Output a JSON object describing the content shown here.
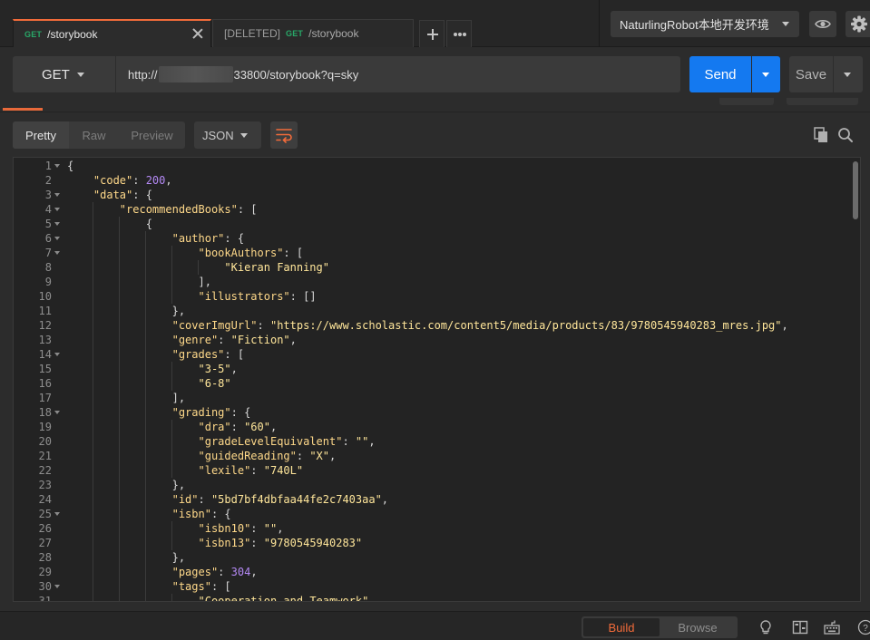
{
  "tabs": [
    {
      "method": "GET",
      "prefix": "",
      "path": "/storybook",
      "active": true
    },
    {
      "method": "GET",
      "prefix": "[DELETED]",
      "path": "/storybook",
      "active": false
    }
  ],
  "environment": {
    "selected": "NaturlingRobot本地开发环境"
  },
  "request": {
    "method": "GET",
    "url_prefix": "http://",
    "url_suffix": "33800/storybook?q=sky",
    "send_label": "Send",
    "save_label": "Save"
  },
  "response_toolbar": {
    "views": [
      "Pretty",
      "Raw",
      "Preview"
    ],
    "active_view": "Pretty",
    "format": "JSON"
  },
  "code_lines": [
    {
      "n": "1",
      "fold": true,
      "indent": 0,
      "tokens": [
        [
          "p",
          "{"
        ]
      ]
    },
    {
      "n": "2",
      "fold": false,
      "indent": 1,
      "tokens": [
        [
          "k",
          "\"code\""
        ],
        [
          "p",
          ": "
        ],
        [
          "n",
          "200"
        ],
        [
          "p",
          ","
        ]
      ]
    },
    {
      "n": "3",
      "fold": true,
      "indent": 1,
      "tokens": [
        [
          "k",
          "\"data\""
        ],
        [
          "p",
          ": {"
        ]
      ]
    },
    {
      "n": "4",
      "fold": true,
      "indent": 2,
      "tokens": [
        [
          "k",
          "\"recommendedBooks\""
        ],
        [
          "p",
          ": ["
        ]
      ]
    },
    {
      "n": "5",
      "fold": true,
      "indent": 3,
      "tokens": [
        [
          "p",
          "{"
        ]
      ]
    },
    {
      "n": "6",
      "fold": true,
      "indent": 4,
      "tokens": [
        [
          "k",
          "\"author\""
        ],
        [
          "p",
          ": {"
        ]
      ]
    },
    {
      "n": "7",
      "fold": true,
      "indent": 5,
      "tokens": [
        [
          "k",
          "\"bookAuthors\""
        ],
        [
          "p",
          ": ["
        ]
      ]
    },
    {
      "n": "8",
      "fold": false,
      "indent": 6,
      "tokens": [
        [
          "s",
          "\"Kieran Fanning\""
        ]
      ]
    },
    {
      "n": "9",
      "fold": false,
      "indent": 5,
      "tokens": [
        [
          "p",
          "],"
        ]
      ]
    },
    {
      "n": "10",
      "fold": false,
      "indent": 5,
      "tokens": [
        [
          "k",
          "\"illustrators\""
        ],
        [
          "p",
          ": []"
        ]
      ]
    },
    {
      "n": "11",
      "fold": false,
      "indent": 4,
      "tokens": [
        [
          "p",
          "},"
        ]
      ]
    },
    {
      "n": "12",
      "fold": false,
      "indent": 4,
      "tokens": [
        [
          "k",
          "\"coverImgUrl\""
        ],
        [
          "p",
          ": "
        ],
        [
          "s",
          "\"https://www.scholastic.com/content5/media/products/83/9780545940283_mres.jpg\""
        ],
        [
          "p",
          ","
        ]
      ]
    },
    {
      "n": "13",
      "fold": false,
      "indent": 4,
      "tokens": [
        [
          "k",
          "\"genre\""
        ],
        [
          "p",
          ": "
        ],
        [
          "s",
          "\"Fiction\""
        ],
        [
          "p",
          ","
        ]
      ]
    },
    {
      "n": "14",
      "fold": true,
      "indent": 4,
      "tokens": [
        [
          "k",
          "\"grades\""
        ],
        [
          "p",
          ": ["
        ]
      ]
    },
    {
      "n": "15",
      "fold": false,
      "indent": 5,
      "tokens": [
        [
          "s",
          "\"3-5\""
        ],
        [
          "p",
          ","
        ]
      ]
    },
    {
      "n": "16",
      "fold": false,
      "indent": 5,
      "tokens": [
        [
          "s",
          "\"6-8\""
        ]
      ]
    },
    {
      "n": "17",
      "fold": false,
      "indent": 4,
      "tokens": [
        [
          "p",
          "],"
        ]
      ]
    },
    {
      "n": "18",
      "fold": true,
      "indent": 4,
      "tokens": [
        [
          "k",
          "\"grading\""
        ],
        [
          "p",
          ": {"
        ]
      ]
    },
    {
      "n": "19",
      "fold": false,
      "indent": 5,
      "tokens": [
        [
          "k",
          "\"dra\""
        ],
        [
          "p",
          ": "
        ],
        [
          "s",
          "\"60\""
        ],
        [
          "p",
          ","
        ]
      ]
    },
    {
      "n": "20",
      "fold": false,
      "indent": 5,
      "tokens": [
        [
          "k",
          "\"gradeLevelEquivalent\""
        ],
        [
          "p",
          ": "
        ],
        [
          "s",
          "\"\""
        ],
        [
          "p",
          ","
        ]
      ]
    },
    {
      "n": "21",
      "fold": false,
      "indent": 5,
      "tokens": [
        [
          "k",
          "\"guidedReading\""
        ],
        [
          "p",
          ": "
        ],
        [
          "s",
          "\"X\""
        ],
        [
          "p",
          ","
        ]
      ]
    },
    {
      "n": "22",
      "fold": false,
      "indent": 5,
      "tokens": [
        [
          "k",
          "\"lexile\""
        ],
        [
          "p",
          ": "
        ],
        [
          "s",
          "\"740L\""
        ]
      ]
    },
    {
      "n": "23",
      "fold": false,
      "indent": 4,
      "tokens": [
        [
          "p",
          "},"
        ]
      ]
    },
    {
      "n": "24",
      "fold": false,
      "indent": 4,
      "tokens": [
        [
          "k",
          "\"id\""
        ],
        [
          "p",
          ": "
        ],
        [
          "s",
          "\"5bd7bf4dbfaa44fe2c7403aa\""
        ],
        [
          "p",
          ","
        ]
      ]
    },
    {
      "n": "25",
      "fold": true,
      "indent": 4,
      "tokens": [
        [
          "k",
          "\"isbn\""
        ],
        [
          "p",
          ": {"
        ]
      ]
    },
    {
      "n": "26",
      "fold": false,
      "indent": 5,
      "tokens": [
        [
          "k",
          "\"isbn10\""
        ],
        [
          "p",
          ": "
        ],
        [
          "s",
          "\"\""
        ],
        [
          "p",
          ","
        ]
      ]
    },
    {
      "n": "27",
      "fold": false,
      "indent": 5,
      "tokens": [
        [
          "k",
          "\"isbn13\""
        ],
        [
          "p",
          ": "
        ],
        [
          "s",
          "\"9780545940283\""
        ]
      ]
    },
    {
      "n": "28",
      "fold": false,
      "indent": 4,
      "tokens": [
        [
          "p",
          "},"
        ]
      ]
    },
    {
      "n": "29",
      "fold": false,
      "indent": 4,
      "tokens": [
        [
          "k",
          "\"pages\""
        ],
        [
          "p",
          ": "
        ],
        [
          "n",
          "304"
        ],
        [
          "p",
          ","
        ]
      ]
    },
    {
      "n": "30",
      "fold": true,
      "indent": 4,
      "tokens": [
        [
          "k",
          "\"tags\""
        ],
        [
          "p",
          ": ["
        ]
      ]
    },
    {
      "n": "31",
      "fold": false,
      "indent": 5,
      "tokens": [
        [
          "s",
          "\"Cooperation and Teamwork\""
        ]
      ]
    }
  ],
  "statusbar": {
    "build_label": "Build",
    "browse_label": "Browse",
    "active": "Build"
  },
  "colors": {
    "accent": "#f26b3a",
    "send": "#1479f0",
    "method_get": "#28a868"
  }
}
